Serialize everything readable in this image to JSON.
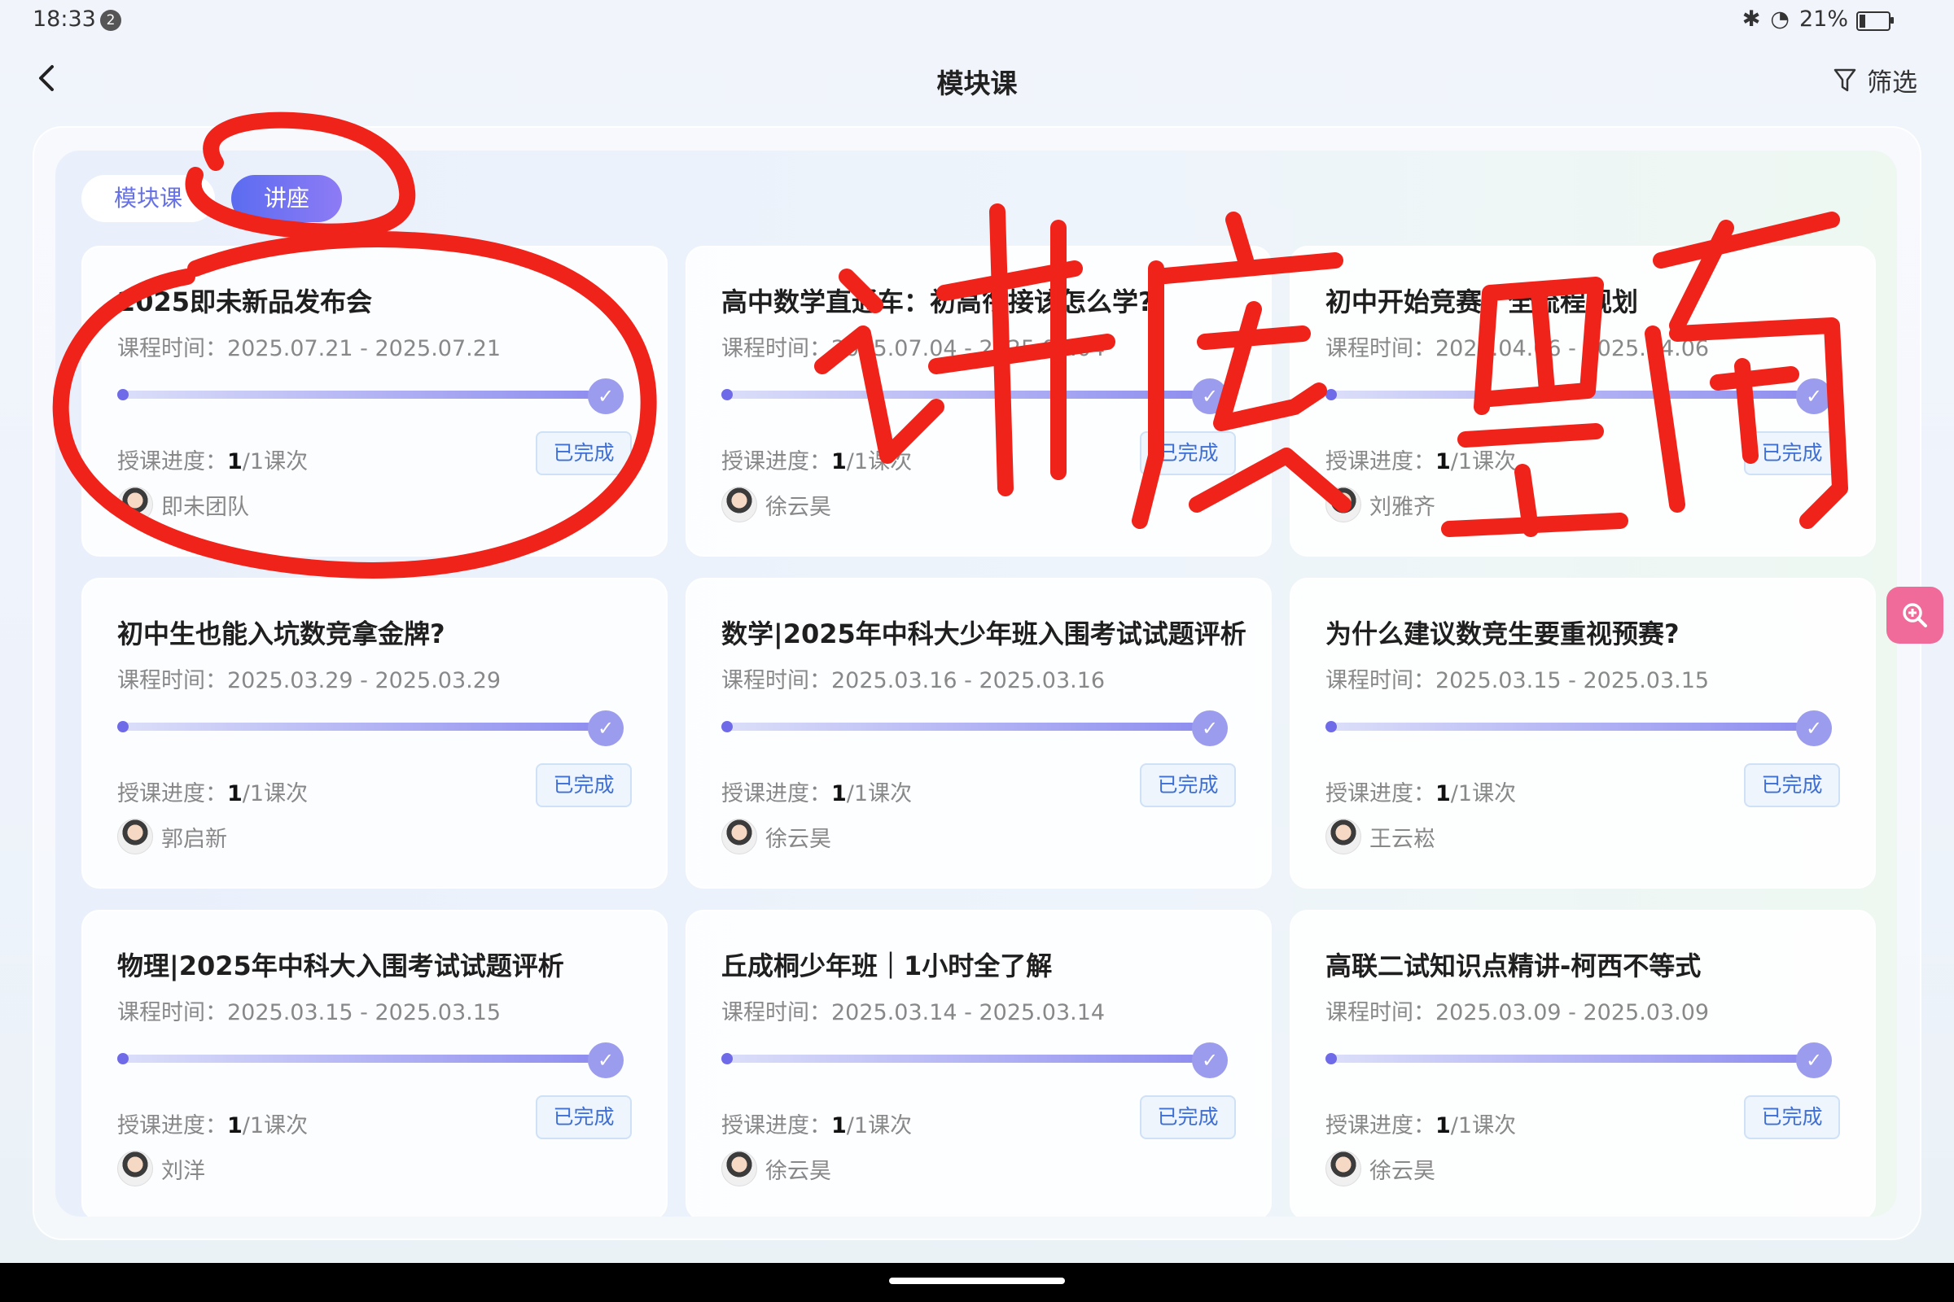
{
  "status_bar": {
    "time": "18:33",
    "notification_count": "2",
    "battery": "21%"
  },
  "nav": {
    "title": "模块课",
    "filter_label": "筛选"
  },
  "tabs": [
    {
      "label": "模块课"
    },
    {
      "label": "讲座"
    }
  ],
  "cards": [
    {
      "title": "2025即未新品发布会",
      "time_label": "课程时间：",
      "time": "2025.07.21 - 2025.07.21",
      "progress_label": "授课进度：",
      "progress_done": "1",
      "progress_total": "/1课次",
      "status": "已完成",
      "teacher": "即未团队"
    },
    {
      "title": "高中数学直通车：初高衔接该怎么学?",
      "time_label": "课程时间：",
      "time": "2025.07.04 - 2025.07.04",
      "progress_label": "授课进度：",
      "progress_done": "1",
      "progress_total": "/1课次",
      "status": "已完成",
      "teacher": "徐云昊"
    },
    {
      "title": "初中开始竞赛，全流程规划",
      "time_label": "课程时间：",
      "time": "2025.04.06 - 2025.04.06",
      "progress_label": "授课进度：",
      "progress_done": "1",
      "progress_total": "/1课次",
      "status": "已完成",
      "teacher": "刘雅齐"
    },
    {
      "title": "初中生也能入坑数竞拿金牌?",
      "time_label": "课程时间：",
      "time": "2025.03.29 - 2025.03.29",
      "progress_label": "授课进度：",
      "progress_done": "1",
      "progress_total": "/1课次",
      "status": "已完成",
      "teacher": "郭启新"
    },
    {
      "title": "数学|2025年中科大少年班入围考试试题评析",
      "time_label": "课程时间：",
      "time": "2025.03.16 - 2025.03.16",
      "progress_label": "授课进度：",
      "progress_done": "1",
      "progress_total": "/1课次",
      "status": "已完成",
      "teacher": "徐云昊"
    },
    {
      "title": "为什么建议数竞生要重视预赛?",
      "time_label": "课程时间：",
      "time": "2025.03.15 - 2025.03.15",
      "progress_label": "授课进度：",
      "progress_done": "1",
      "progress_total": "/1课次",
      "status": "已完成",
      "teacher": "王云崧"
    },
    {
      "title": "物理|2025年中科大入围考试试题评析",
      "time_label": "课程时间：",
      "time": "2025.03.15 - 2025.03.15",
      "progress_label": "授课进度：",
      "progress_done": "1",
      "progress_total": "/1课次",
      "status": "已完成",
      "teacher": "刘洋"
    },
    {
      "title": "丘成桐少年班｜1小时全了解",
      "time_label": "课程时间：",
      "time": "2025.03.14 - 2025.03.14",
      "progress_label": "授课进度：",
      "progress_done": "1",
      "progress_total": "/1课次",
      "status": "已完成",
      "teacher": "徐云昊"
    },
    {
      "title": "高联二试知识点精讲-柯西不等式",
      "time_label": "课程时间：",
      "time": "2025.03.09 - 2025.03.09",
      "progress_label": "授课进度：",
      "progress_done": "1",
      "progress_total": "/1课次",
      "status": "已完成",
      "teacher": "徐云昊"
    }
  ],
  "annotation": {
    "handwritten_text": "讲座里面",
    "color": "#f0231a"
  },
  "colors": {
    "accent": "#6671e8",
    "status_text": "#3d6fd6",
    "fab": "#f06a9a"
  }
}
